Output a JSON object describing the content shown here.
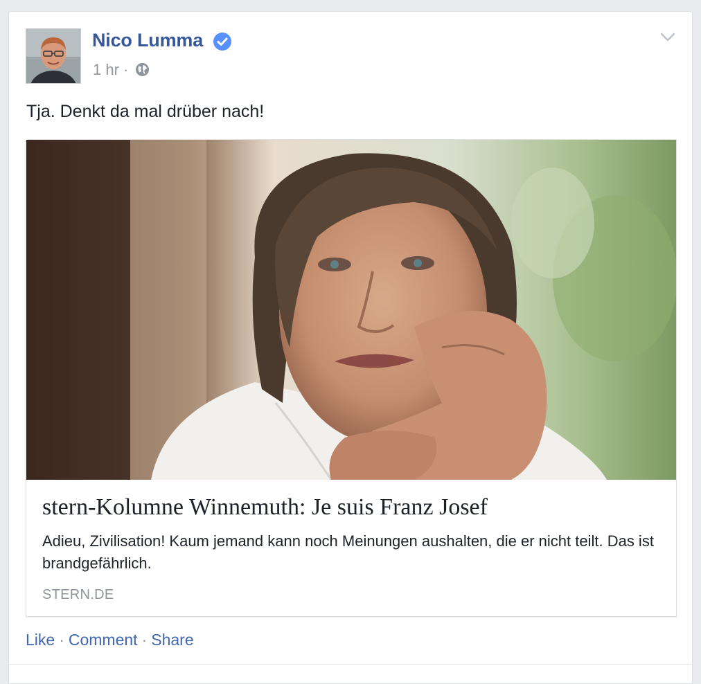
{
  "post": {
    "author": "Nico Lumma",
    "verified": true,
    "timestamp": "1 hr",
    "meta_separator": "·",
    "privacy_icon": "globe-icon",
    "text": "Tja. Denkt da mal drüber nach!"
  },
  "link_preview": {
    "title": "stern-Kolumne Winnemuth: Je suis Franz Josef",
    "description": "Adieu, Zivilisation! Kaum jemand kann noch Meinungen aushalten, die er nicht teilt. Das ist brandgefährlich.",
    "domain": "STERN.DE"
  },
  "actions": {
    "like": "Like",
    "comment": "Comment",
    "share": "Share",
    "separator": "·"
  },
  "colors": {
    "link_blue": "#365899",
    "action_blue": "#4267b2",
    "verified_blue": "#5890ff",
    "meta_gray": "#90949c",
    "text": "#1d2129"
  }
}
